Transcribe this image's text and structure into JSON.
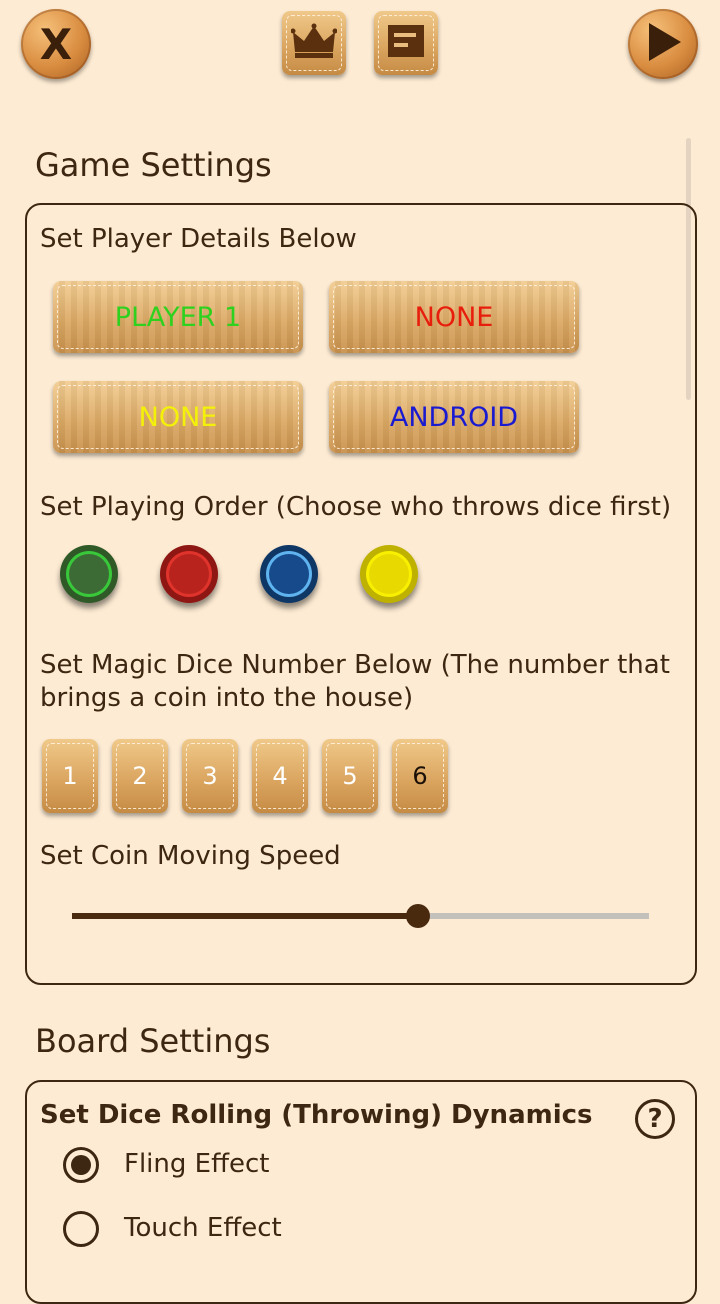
{
  "toolbar": {
    "close_label": "X",
    "crown_icon": "crown-icon",
    "list_icon": "list-icon",
    "play_icon": "play-icon"
  },
  "game_settings": {
    "title": "Game Settings",
    "player_details_label": "Set Player Details Below",
    "players": [
      {
        "label": "PLAYER 1",
        "color": "#2fd11f"
      },
      {
        "label": "NONE",
        "color": "#e81e0c"
      },
      {
        "label": "NONE",
        "color": "#f3f10a"
      },
      {
        "label": "ANDROID",
        "color": "#1a1ad0"
      }
    ],
    "playing_order_label": "Set Playing Order (Choose who throws dice first)",
    "order_coins": [
      {
        "name": "green",
        "color": "#3d6b35",
        "ring": "#38c83a"
      },
      {
        "name": "red",
        "color": "#b8231d",
        "ring": "#e0332b"
      },
      {
        "name": "blue",
        "color": "#164a8a",
        "ring": "#5fb3ee"
      },
      {
        "name": "yellow",
        "color": "#e8da00",
        "ring": "#f8f000"
      }
    ],
    "magic_dice_label_line1": "Set Magic Dice Number Below (The number that",
    "magic_dice_label_line2": "brings a coin into the house)",
    "dice_numbers": [
      "1",
      "2",
      "3",
      "4",
      "5",
      "6"
    ],
    "selected_dice": "6",
    "speed_label": "Set Coin Moving Speed",
    "speed_value_percent": 60
  },
  "board_settings": {
    "title": "Board Settings",
    "dice_dynamics_label": "Set Dice Rolling (Throwing) Dynamics",
    "help_label": "?",
    "options": [
      {
        "label": "Fling Effect",
        "selected": true
      },
      {
        "label": "Touch Effect",
        "selected": false
      }
    ]
  }
}
